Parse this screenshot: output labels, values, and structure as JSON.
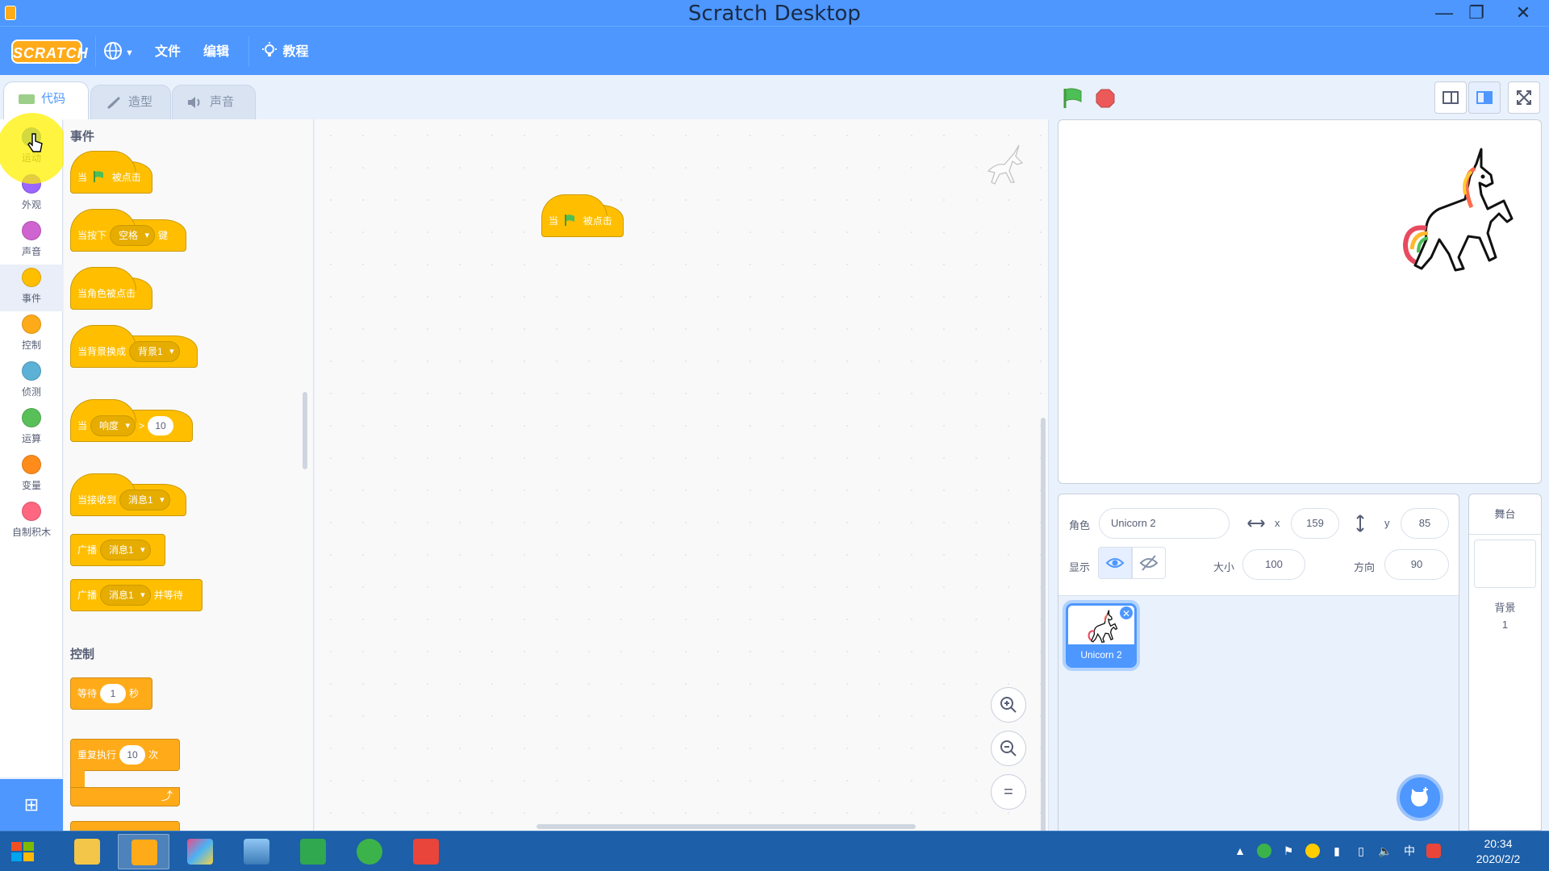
{
  "window": {
    "title": "Scratch Desktop"
  },
  "menu": {
    "logo": "SCRATCH",
    "file": "文件",
    "edit": "编辑",
    "tutorials": "教程"
  },
  "tabs": [
    {
      "label": "代码",
      "active": true
    },
    {
      "label": "造型",
      "active": false
    },
    {
      "label": "声音",
      "active": false
    }
  ],
  "categories": [
    {
      "label": "运动",
      "color": "#4c97ff"
    },
    {
      "label": "外观",
      "color": "#9966ff"
    },
    {
      "label": "声音",
      "color": "#cf63cf"
    },
    {
      "label": "事件",
      "color": "#ffbf00",
      "selected": true
    },
    {
      "label": "控制",
      "color": "#ffab19"
    },
    {
      "label": "侦测",
      "color": "#5cb1d6"
    },
    {
      "label": "运算",
      "color": "#59c059"
    },
    {
      "label": "变量",
      "color": "#ff8c1a"
    },
    {
      "label": "自制积木",
      "color": "#ff6680"
    }
  ],
  "palette": {
    "events_heading": "事件",
    "control_heading": "控制",
    "blocks": {
      "when_flag": {
        "pre": "当",
        "post": "被点击"
      },
      "when_key": {
        "pre": "当按下",
        "menu": "空格",
        "post": "键"
      },
      "when_sprite_clicked": {
        "text": "当角色被点击"
      },
      "when_backdrop": {
        "pre": "当背景换成",
        "menu": "背景1"
      },
      "when_gt": {
        "pre": "当",
        "menu": "响度",
        "op": ">",
        "value": "10"
      },
      "when_receive": {
        "pre": "当接收到",
        "menu": "消息1"
      },
      "broadcast": {
        "pre": "广播",
        "menu": "消息1"
      },
      "broadcast_wait": {
        "pre": "广播",
        "menu": "消息1",
        "post": "并等待"
      },
      "wait": {
        "pre": "等待",
        "value": "1",
        "post": "秒"
      },
      "repeat": {
        "pre": "重复执行",
        "value": "10",
        "post": "次"
      }
    }
  },
  "workspace": {
    "script_block": {
      "pre": "当",
      "post": "被点击"
    },
    "zoom_in": "+",
    "zoom_out": "−",
    "zoom_reset": "="
  },
  "sprite_info": {
    "sprite_label": "角色",
    "sprite_name": "Unicorn 2",
    "x_label": "x",
    "x_value": "159",
    "y_label": "y",
    "y_value": "85",
    "show_label": "显示",
    "size_label": "大小",
    "size_value": "100",
    "direction_label": "方向",
    "direction_value": "90"
  },
  "sprites": [
    {
      "name": "Unicorn 2",
      "selected": true
    }
  ],
  "stage_pane": {
    "title": "舞台",
    "backdrops_label": "背景",
    "backdrops_count": "1"
  },
  "taskbar": {
    "time": "20:34",
    "date": "2020/2/2",
    "ime": "中"
  }
}
